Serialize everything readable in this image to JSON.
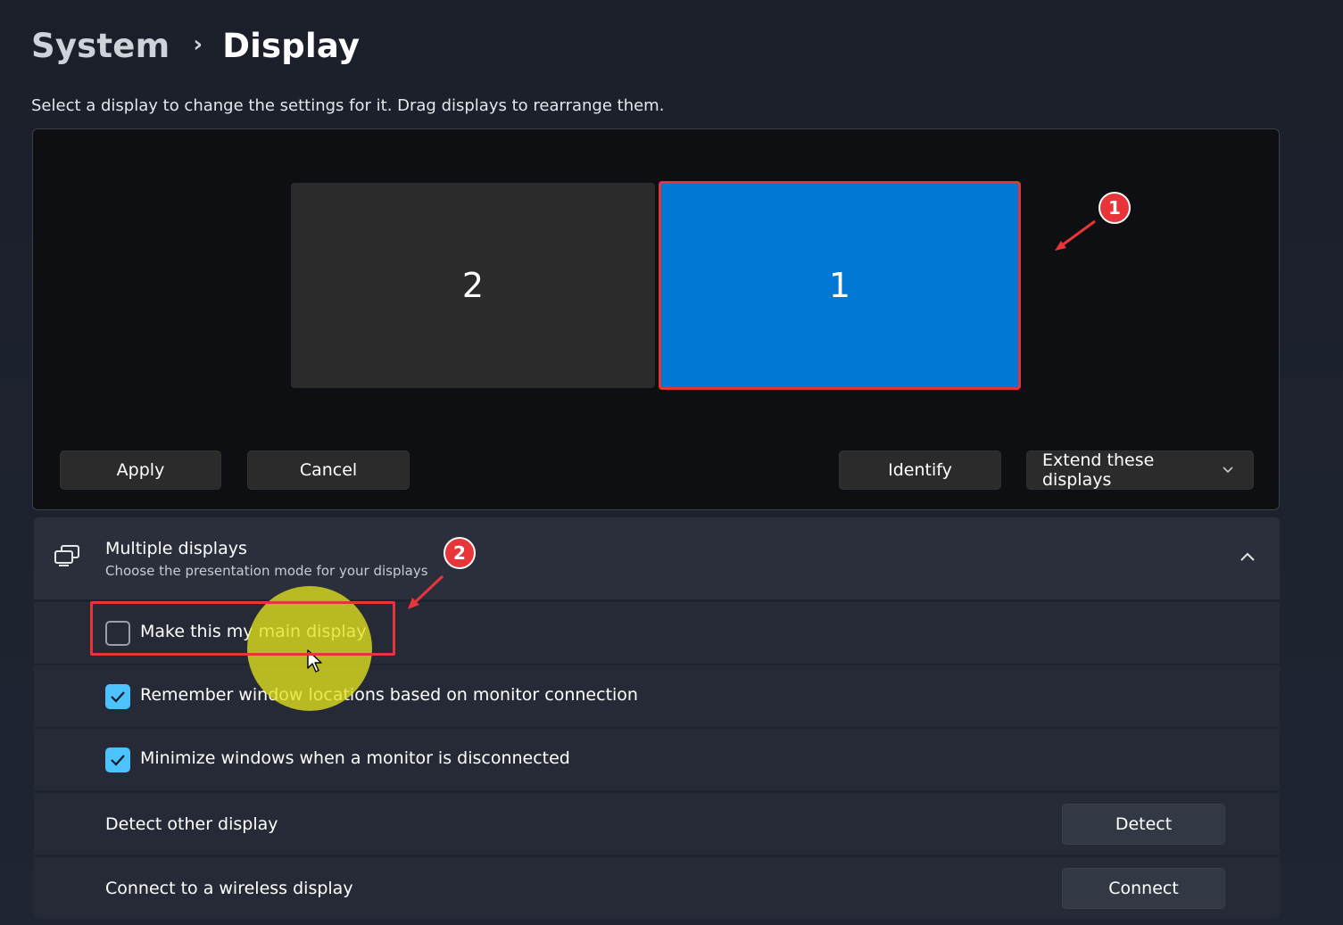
{
  "breadcrumb": {
    "parent": "System",
    "separator": "›",
    "current": "Display"
  },
  "subtitle": "Select a display to change the settings for it. Drag displays to rearrange them.",
  "arrangement": {
    "monitors": [
      {
        "label": "2",
        "selected": false,
        "color": "#2b2b2b"
      },
      {
        "label": "1",
        "selected": true,
        "color": "#0078d4"
      }
    ],
    "buttons": {
      "apply": "Apply",
      "cancel": "Cancel",
      "identify": "Identify",
      "mode_select": "Extend these displays"
    }
  },
  "annotations": {
    "badge_1": "1",
    "badge_2": "2",
    "highlight_color": "#e5353a"
  },
  "multiple_displays": {
    "title": "Multiple displays",
    "description": "Choose the presentation mode for your displays",
    "expanded": true,
    "options": [
      {
        "label": "Make this my main display",
        "checked": false
      },
      {
        "label": "Remember window locations based on monitor connection",
        "checked": true
      },
      {
        "label": "Minimize windows when a monitor is disconnected",
        "checked": true
      }
    ],
    "detect": {
      "label": "Detect other display",
      "button": "Detect"
    },
    "wireless": {
      "label": "Connect to a wireless display",
      "button": "Connect"
    }
  },
  "colors": {
    "accent": "#0078d4",
    "checkbox_checked": "#4cc2ff",
    "annotation_red": "#e8353a",
    "cursor_highlight": "#e1e11e"
  }
}
